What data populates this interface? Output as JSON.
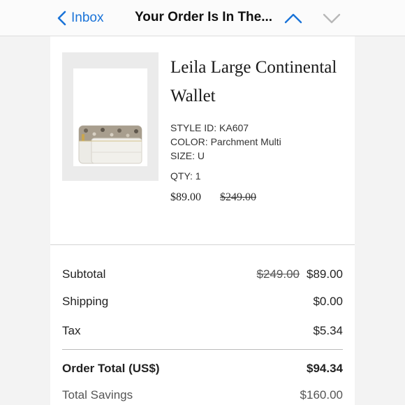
{
  "nav": {
    "back_label": "Inbox",
    "title": "Your Order Is In The..."
  },
  "product": {
    "name": "Leila Large Continental Wallet",
    "style_id": "STYLE ID: KA607",
    "color": "COLOR: Parchment Multi",
    "size": "SIZE: U",
    "qty": "QTY: 1",
    "sale_price": "$89.00",
    "original_price": "$249.00"
  },
  "summary": {
    "subtotal_label": "Subtotal",
    "subtotal_original": "$249.00",
    "subtotal_value": "$89.00",
    "shipping_label": "Shipping",
    "shipping_value": "$0.00",
    "tax_label": "Tax",
    "tax_value": "$5.34",
    "order_total_label": "Order Total (US$)",
    "order_total_value": "$94.34",
    "savings_label": "Total Savings",
    "savings_value": "$160.00"
  },
  "colors": {
    "accent": "#1a73d8",
    "disabled_arrow": "#b8b8b8"
  },
  "icons": {
    "back": "chevron-left-icon",
    "previous": "chevron-up-icon",
    "next": "chevron-down-icon",
    "product_image": "wallet-image"
  }
}
